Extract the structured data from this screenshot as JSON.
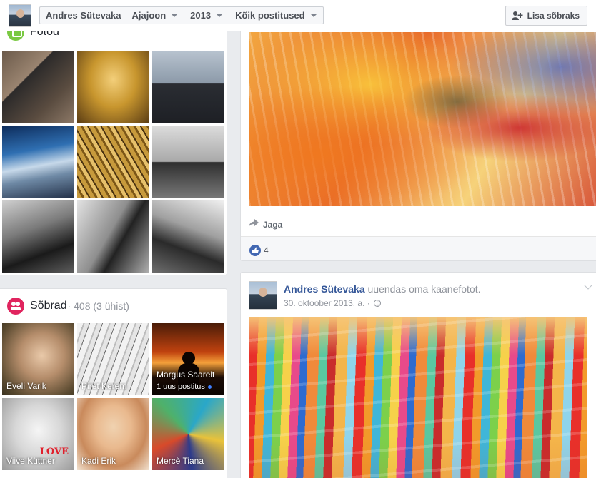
{
  "topbar": {
    "crumbs": [
      "Andres Sütevaka",
      "Ajajoon",
      "2013",
      "Kõik postitused"
    ],
    "add_friend_label": "Lisa sõbraks"
  },
  "photos": {
    "title": "Fotod",
    "items": [
      "photo-1",
      "photo-2",
      "photo-3",
      "photo-4",
      "photo-5",
      "photo-6",
      "photo-7",
      "photo-8",
      "photo-9"
    ]
  },
  "friends": {
    "title": "Sõbrad",
    "count": "· 408 (3 ühist)",
    "items": [
      {
        "name": "Eveli Varik"
      },
      {
        "name": "Piret Kerem"
      },
      {
        "name": "Margus Saarelt",
        "sub": "1 uus postitus"
      },
      {
        "name": "Viive Küttner",
        "overlay": "LOVE"
      },
      {
        "name": "Kadi Erik"
      },
      {
        "name": "Mercè Tiana"
      }
    ]
  },
  "post_top": {
    "share_label": "Jaga",
    "likes_count": "4"
  },
  "post2": {
    "author": "Andres Sütevaka",
    "action": " uuendas oma kaanefotot.",
    "date": "30. oktoober 2013. a. ·"
  },
  "colors": {
    "link": "#365899",
    "like_blue": "#4267b2",
    "photos_green": "#7ac943",
    "friends_pink": "#e0245e"
  }
}
